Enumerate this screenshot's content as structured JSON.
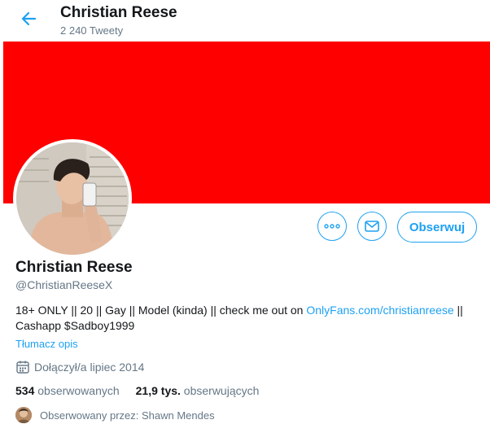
{
  "header": {
    "name": "Christian Reese",
    "tweet_count": "2 240 Tweety"
  },
  "banner": {
    "color": "#ff0000"
  },
  "actions": {
    "more_icon": "more-icon",
    "message_icon": "envelope-icon",
    "follow_label": "Obserwuj"
  },
  "profile": {
    "name": "Christian Reese",
    "handle": "@ChristianReeseX",
    "bio_text": "18+ ONLY || 20 || Gay || Model (kinda) || check me out on ",
    "bio_link": "OnlyFans.com/christianreese",
    "bio_after_link": " || Cashapp $Sadboy1999",
    "translate_label": "Tłumacz opis",
    "joined": "Dołączył/a lipiec 2014",
    "following_count": "534",
    "following_label": "obserwowanych",
    "followers_count": "21,9 tys.",
    "followers_label": "obserwujących",
    "followed_by": "Obserwowany przez: Shawn Mendes"
  },
  "colors": {
    "accent": "#1da1f2",
    "secondary_text": "#657786"
  }
}
